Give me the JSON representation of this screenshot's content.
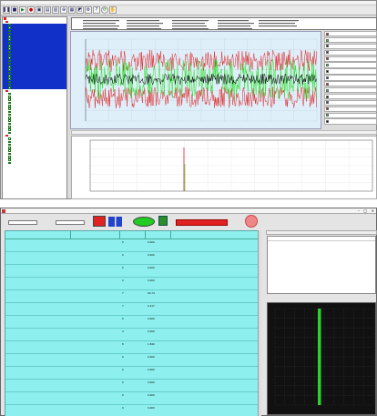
{
  "top": {
    "title": "",
    "menu": [
      "",
      "",
      "",
      "",
      "",
      "",
      "",
      "",
      "",
      ""
    ],
    "toolbar_icons": [
      "pause-icon",
      "stop-icon",
      "play-icon",
      "record-icon",
      "save-icon",
      "open-icon",
      "print-icon",
      "zoom-icon",
      "grid-icon",
      "chart-icon",
      "settings-icon",
      "help-icon"
    ],
    "tree": {
      "root_label": "",
      "group1_label": "",
      "group1_items": [
        "",
        "",
        "",
        "",
        "",
        "",
        "",
        "",
        "",
        "",
        "",
        "",
        "",
        "",
        "",
        "",
        "",
        "",
        "",
        "",
        "",
        ""
      ],
      "group2_label": "",
      "group2_items": [
        "",
        "",
        "",
        "",
        "",
        "",
        "",
        "",
        "",
        "",
        "",
        "",
        "",
        ""
      ],
      "group3_label": "",
      "group3_items": [
        "",
        "",
        "",
        "",
        "",
        "",
        "",
        "",
        ""
      ]
    },
    "info_lines": [
      "",
      "",
      "",
      "",
      "",
      ""
    ],
    "legend_items": [
      "",
      "",
      "",
      "",
      "",
      "",
      "",
      "",
      "",
      "",
      "",
      "",
      "",
      "",
      ""
    ],
    "spectrum_label": "",
    "colors": {
      "signal_red": "#e02020",
      "signal_green": "#21e021",
      "signal_black": "#000000",
      "tree_select": "#1030c8",
      "grid_bg": "#ffffff"
    }
  },
  "bottom": {
    "title": "",
    "fields": [
      {
        "label": "",
        "value": ""
      },
      {
        "label": "",
        "value": ""
      }
    ],
    "table": {
      "headers": [
        "",
        "",
        "",
        "",
        ""
      ],
      "rows": [
        {
          "c1": "",
          "c2": "",
          "c3": "0",
          "c4": "0.000",
          "c5": ""
        },
        {
          "c1": "",
          "c2": "",
          "c3": "0",
          "c4": "0.000",
          "c5": ""
        },
        {
          "c1": "",
          "c2": "",
          "c3": "0",
          "c4": "0.000",
          "c5": ""
        },
        {
          "c1": "",
          "c2": "",
          "c3": "0",
          "c4": "0.000",
          "c5": ""
        },
        {
          "c1": "",
          "c2": "",
          "c3": "7",
          "c4": "24.74",
          "c5": ""
        },
        {
          "c1": "",
          "c2": "",
          "c3": "7",
          "c4": "0.217",
          "c5": ""
        },
        {
          "c1": "",
          "c2": "",
          "c3": "0",
          "c4": "0.000",
          "c5": ""
        },
        {
          "c1": "",
          "c2": "",
          "c3": "4",
          "c4": "0.000",
          "c5": ""
        },
        {
          "c1": "",
          "c2": "",
          "c3": "8",
          "c4": "1.840",
          "c5": ""
        },
        {
          "c1": "",
          "c2": "",
          "c3": "0",
          "c4": "0.000",
          "c5": ""
        },
        {
          "c1": "",
          "c2": "",
          "c3": "0",
          "c4": "0.000",
          "c5": ""
        },
        {
          "c1": "",
          "c2": "",
          "c3": "0",
          "c4": "0.000",
          "c5": ""
        },
        {
          "c1": "",
          "c2": "",
          "c3": "0",
          "c4": "0.000",
          "c5": ""
        },
        {
          "c1": "",
          "c2": "",
          "c3": "0",
          "c4": "0.000",
          "c5": ""
        }
      ]
    },
    "right_header": "",
    "log_headers": [
      "",
      "",
      ""
    ],
    "log_lines": [
      "",
      "",
      "",
      "",
      "",
      "",
      "",
      "",
      "",
      "",
      ""
    ],
    "spectrum_title": "",
    "colors": {
      "table_bg": "#8ef0ee",
      "log_green": "#33bb33",
      "btn_red": "#e02222",
      "btn_blue": "#2244cc",
      "btn_green": "#22cc22"
    }
  }
}
